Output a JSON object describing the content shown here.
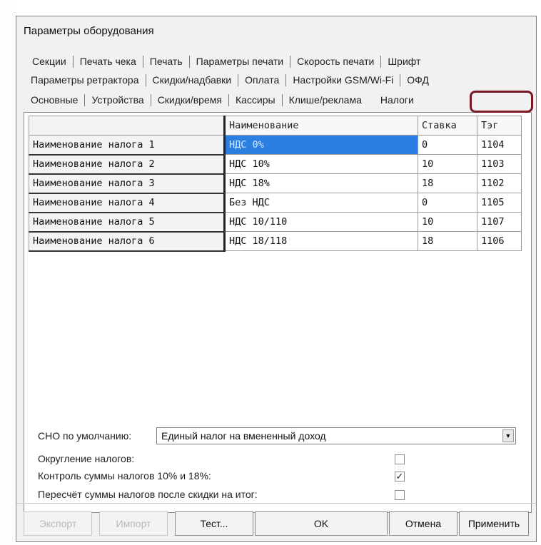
{
  "window": {
    "title": "Параметры оборудования"
  },
  "tabs": {
    "row1": [
      "Секции",
      "Печать чека",
      "Печать",
      "Параметры печати",
      "Скорость печати",
      "Шрифт"
    ],
    "row2": [
      "Параметры ретрактора",
      "Скидки/надбавки",
      "Оплата",
      "Настройки GSM/Wi-Fi",
      "ОФД"
    ],
    "row3": [
      "Основные",
      "Устройства",
      "Скидки/время",
      "Кассиры",
      "Клише/реклама",
      "Налоги"
    ],
    "active": "Налоги"
  },
  "table": {
    "headers": [
      "Наименование",
      "Ставка",
      "Тэг"
    ],
    "rows": [
      {
        "label": "Наименование налога 1",
        "name": "НДС 0%",
        "rate": "0",
        "tag": "1104"
      },
      {
        "label": "Наименование налога 2",
        "name": "НДС 10%",
        "rate": "10",
        "tag": "1103"
      },
      {
        "label": "Наименование налога 3",
        "name": "НДС 18%",
        "rate": "18",
        "tag": "1102"
      },
      {
        "label": "Наименование налога 4",
        "name": "Без НДС",
        "rate": "0",
        "tag": "1105"
      },
      {
        "label": "Наименование налога 5",
        "name": "НДС 10/110",
        "rate": "10",
        "tag": "1107"
      },
      {
        "label": "Наименование налога 6",
        "name": "НДС 18/118",
        "rate": "18",
        "tag": "1106"
      }
    ]
  },
  "sno": {
    "label": "СНО по умолчанию:",
    "value": "Единый налог на вмененный доход"
  },
  "options": [
    {
      "label": "Округление налогов:",
      "checked": false
    },
    {
      "label": "Контроль суммы налогов 10% и 18%:",
      "checked": true
    },
    {
      "label": "Пересчёт суммы налогов после скидки на итог:",
      "checked": false
    }
  ],
  "buttons": {
    "export": "Экспорт",
    "import": "Импорт",
    "test": "Тест...",
    "ok": "OK",
    "cancel": "Отмена",
    "apply": "Применить"
  },
  "colors": {
    "selection": "#2a7fe0",
    "highlight_ring": "#7a1725"
  }
}
